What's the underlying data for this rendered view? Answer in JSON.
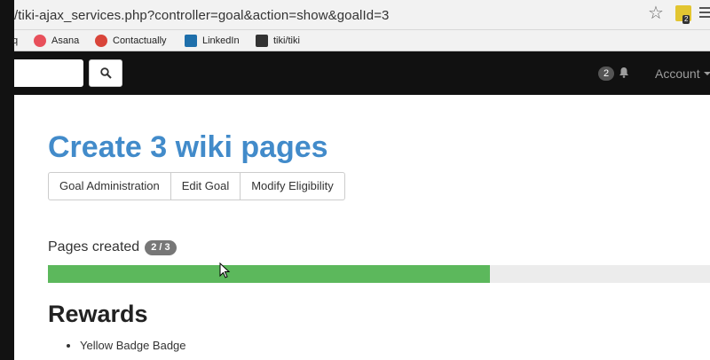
{
  "browser": {
    "url": "/tiki-ajax_services.php?controller=goal&action=show&goalId=3",
    "extension_badge": "2",
    "bookmarks": [
      {
        "label": "q",
        "icon": "",
        "color": ""
      },
      {
        "label": "Asana",
        "icon": "asana-icon",
        "color": "#e8505b"
      },
      {
        "label": "Contactually",
        "icon": "contactually-icon",
        "color": "#d9453a"
      },
      {
        "label": "LinkedIn",
        "icon": "linkedin-icon",
        "color": "#1e6fab"
      },
      {
        "label": "tiki/tiki",
        "icon": "github-icon",
        "color": "#333333"
      }
    ]
  },
  "navbar": {
    "notification_count": "2",
    "account_label": "Account"
  },
  "main": {
    "title": "Create 3 wiki pages",
    "actions": [
      "Goal Administration",
      "Edit Goal",
      "Modify Eligibility"
    ],
    "progress": {
      "label": "Pages created",
      "badge": "2 / 3",
      "fraction": 0.667,
      "color": "#5cb85c"
    },
    "rewards_title": "Rewards",
    "rewards": [
      "Yellow Badge Badge"
    ]
  }
}
